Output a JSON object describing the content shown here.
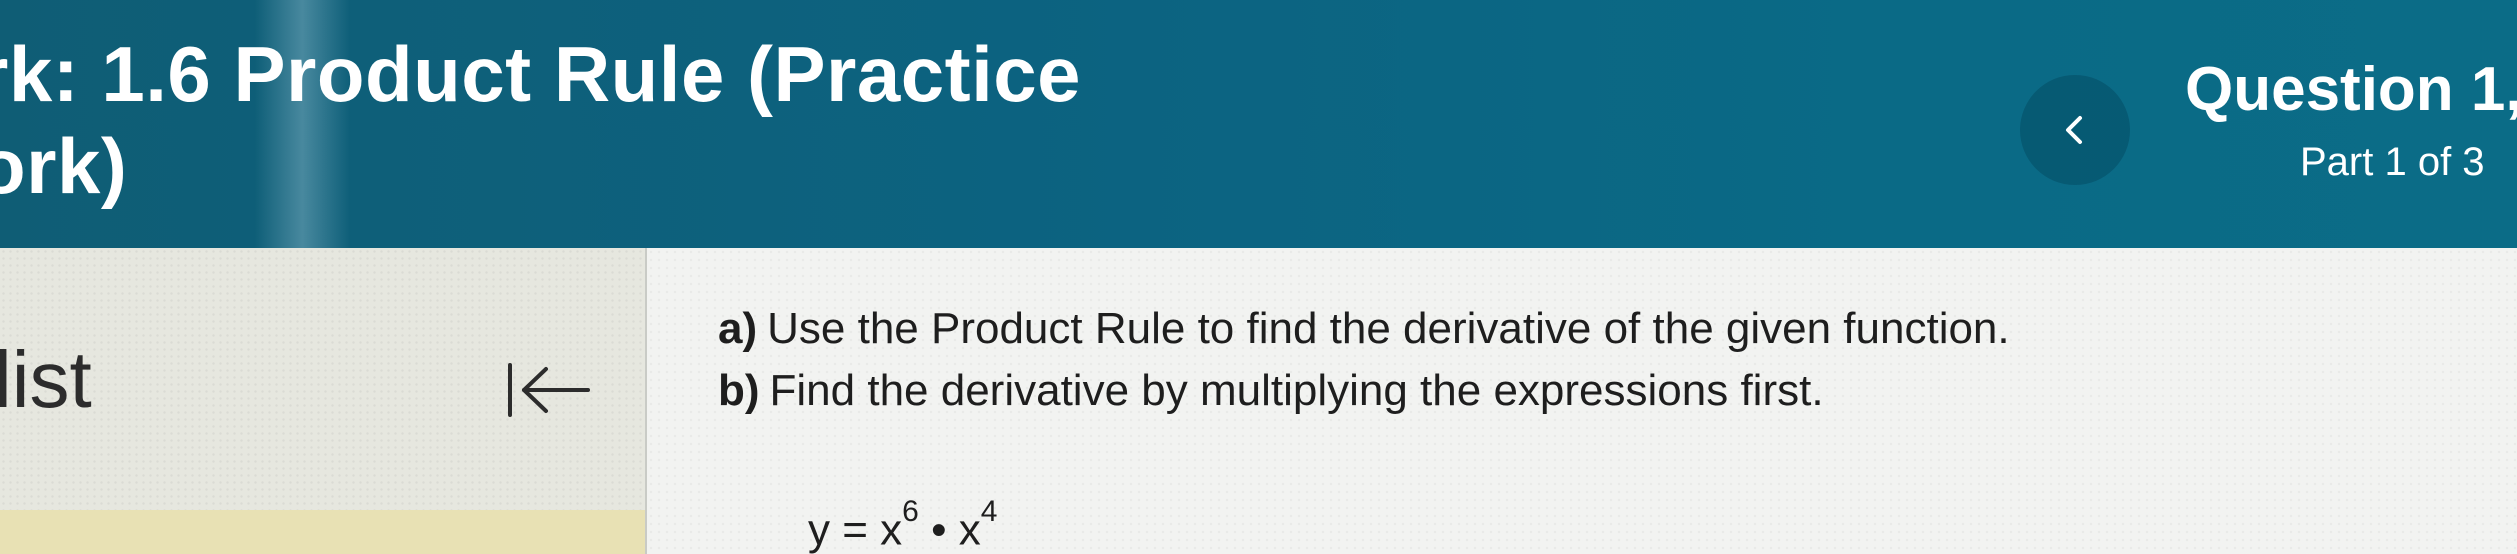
{
  "header": {
    "title_line1": "rk:  1.6 Product Rule (Practice",
    "title_line2": "ork)",
    "back_icon": "chevron-left-icon",
    "question_title": "Question 1,",
    "part_label": "Part 1 of 3"
  },
  "sidebar": {
    "label": "list",
    "collapse_icon": "collapse-left-icon"
  },
  "question": {
    "part_a_marker": "a)",
    "part_a_text": "Use the Product Rule to find the derivative of the given function.",
    "part_b_marker": "b)",
    "part_b_text": "Find the derivative by multiplying the expressions first.",
    "equation": {
      "lhs": "y",
      "equals": "=",
      "base1": "x",
      "exp1": "6",
      "operator": "•",
      "base2": "x",
      "exp2": "4"
    }
  },
  "colors": {
    "header_bg": "#0c6381",
    "header_text": "#ffffff",
    "left_panel_bg": "#e6e7df",
    "main_bg": "#f2f3f1",
    "body_text": "#1e1e1e"
  }
}
